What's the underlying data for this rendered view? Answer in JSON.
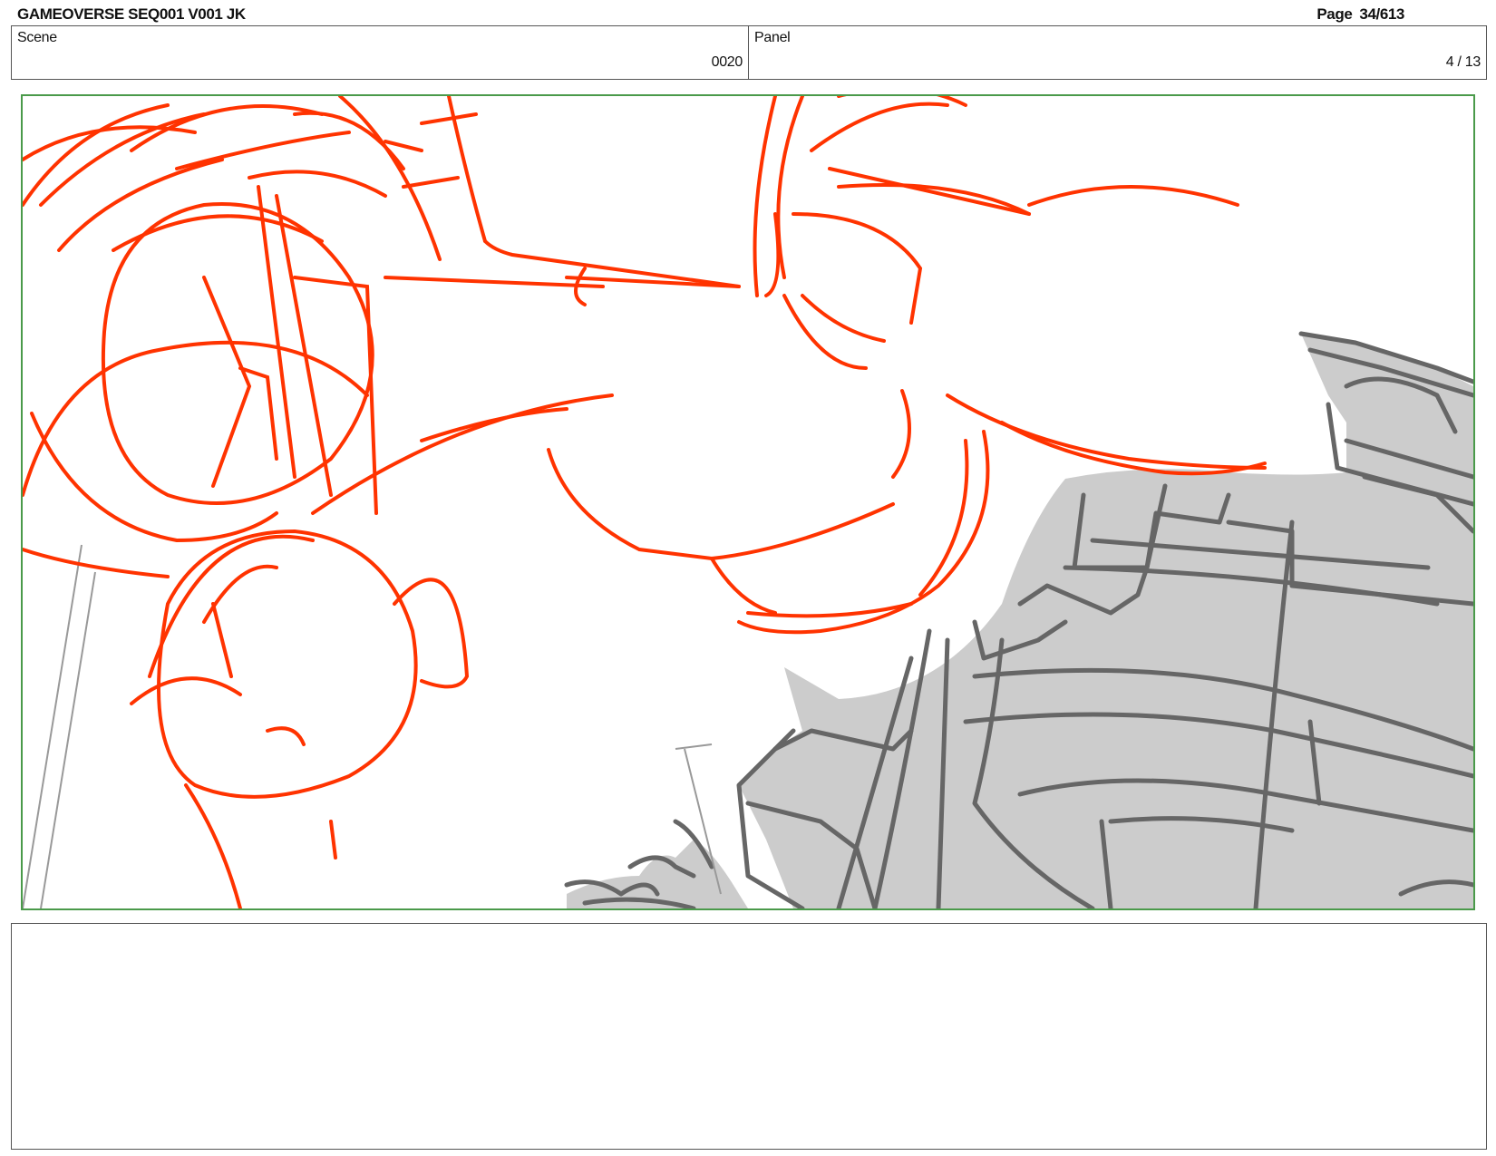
{
  "header": {
    "title": "GAMEOVERSE SEQ001 V001 JK",
    "page_label": "Page",
    "page_value": "34/613"
  },
  "info": {
    "scene_label": "Scene",
    "scene_value": "0020",
    "panel_label": "Panel",
    "panel_value": "4 / 13"
  },
  "notes": {
    "text": ""
  },
  "colors": {
    "sketch_red": "#ff3300",
    "sketch_gray": "#666666",
    "fill_gray": "#cccccc",
    "frame_border": "#4a9a4a"
  }
}
